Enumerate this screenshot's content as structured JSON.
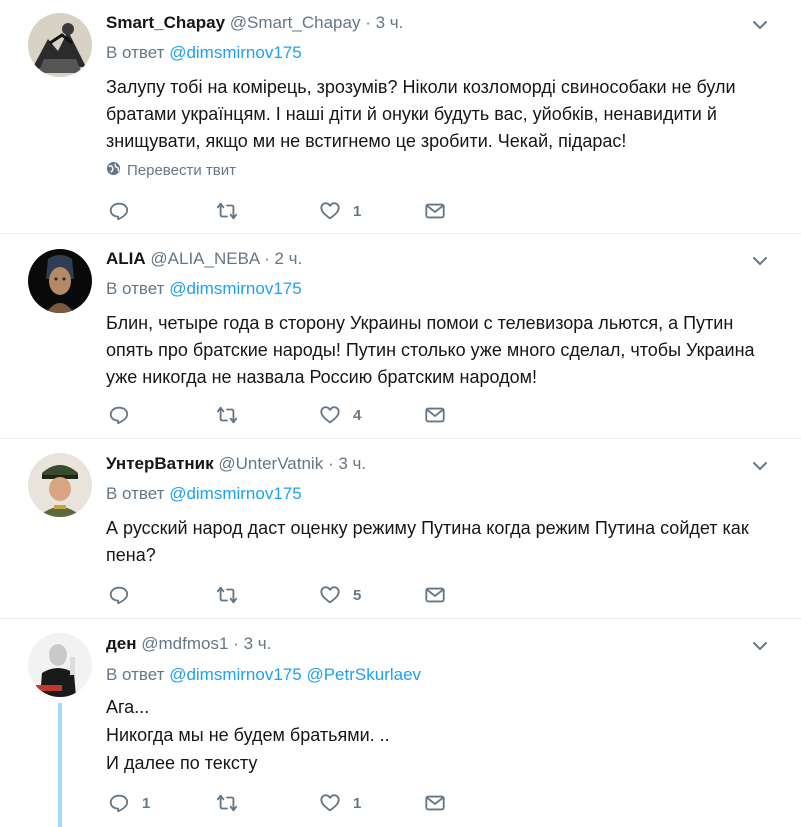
{
  "tweets": [
    {
      "name": "Smart_Chapay",
      "handle": "@Smart_Chapay",
      "separator": "·",
      "time": "3 ч.",
      "reply_prefix": "В ответ",
      "mentions": [
        "@dimsmirnov175"
      ],
      "text": "Залупу тобі на комірець, зрозумів? Ніколи козломорді свинособаки не були братами українцям. І наші діти й онуки будуть вас, уйобків, ненавидити й знищувати, якщо ми не встигнемо це зробити. Чекай, підарас!",
      "translate": "Перевести твит",
      "replies": "",
      "retweets": "",
      "likes": "1"
    },
    {
      "name": "ALIA",
      "handle": "@ALIA_NEBA",
      "separator": "·",
      "time": "2 ч.",
      "reply_prefix": "В ответ",
      "mentions": [
        "@dimsmirnov175"
      ],
      "text": "Блин, четыре года в сторону Украины помои с телевизора льются, а Путин опять про братские народы! Путин столько уже много сделал, чтобы Украина уже никогда не назвала Россию братским народом!",
      "replies": "",
      "retweets": "",
      "likes": "4"
    },
    {
      "name": "УнтерВатник",
      "handle": "@UnterVatnik",
      "separator": "·",
      "time": "3 ч.",
      "reply_prefix": "В ответ",
      "mentions": [
        "@dimsmirnov175"
      ],
      "text": "А русский народ даст оценку режиму Путина когда режим Путина сойдет как пена?",
      "replies": "",
      "retweets": "",
      "likes": "5"
    },
    {
      "name": "ден",
      "handle": "@mdfmos1",
      "separator": "·",
      "time": "3 ч.",
      "reply_prefix": "В ответ",
      "mentions": [
        "@dimsmirnov175",
        "@PetrSkurlaev"
      ],
      "text_lines": [
        "Ага...",
        "Никогда мы не будем братьями. ..",
        "И далее по тексту"
      ],
      "replies": "1",
      "retweets": "",
      "likes": "1"
    }
  ],
  "colors": {
    "accent": "#1da1f2",
    "secondary_text": "#657786",
    "border": "#e6ecf0",
    "thread_line": "#a8daf7"
  }
}
